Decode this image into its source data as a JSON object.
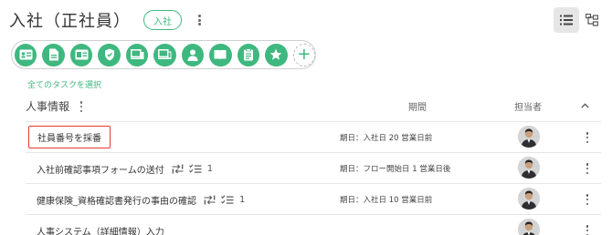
{
  "header": {
    "title": "入社（正社員）",
    "badge": "入社"
  },
  "toolbar": {
    "icons": [
      "id-card-icon",
      "document-icon",
      "id-badge-icon",
      "shield-icon",
      "devices-icon",
      "devices-alt-icon",
      "person-icon",
      "book-icon",
      "clipboard-icon",
      "star-icon"
    ],
    "add_label": "+"
  },
  "select_all_label": "全てのタスクを選択",
  "section": {
    "title": "人事情報",
    "col_period": "期間",
    "col_owner": "担当者"
  },
  "tasks": [
    {
      "name": "社員番号を採番",
      "period": "期日：入社日 20 営業日前",
      "highlighted": true
    },
    {
      "name": "入社前確認事項フォームの送付",
      "period": "期日：フロー開始日 1 営業日後",
      "checklist_count": "1"
    },
    {
      "name": "健康保険_資格確認書発行の事由の確認",
      "period": "期日：入社日 10 営業日前",
      "checklist_count": "1"
    },
    {
      "name": "人事システム（詳細情報）入力",
      "period": "",
      "checklist_count": ""
    }
  ],
  "colors": {
    "accent": "#3fb87f",
    "highlight": "#e53935"
  }
}
